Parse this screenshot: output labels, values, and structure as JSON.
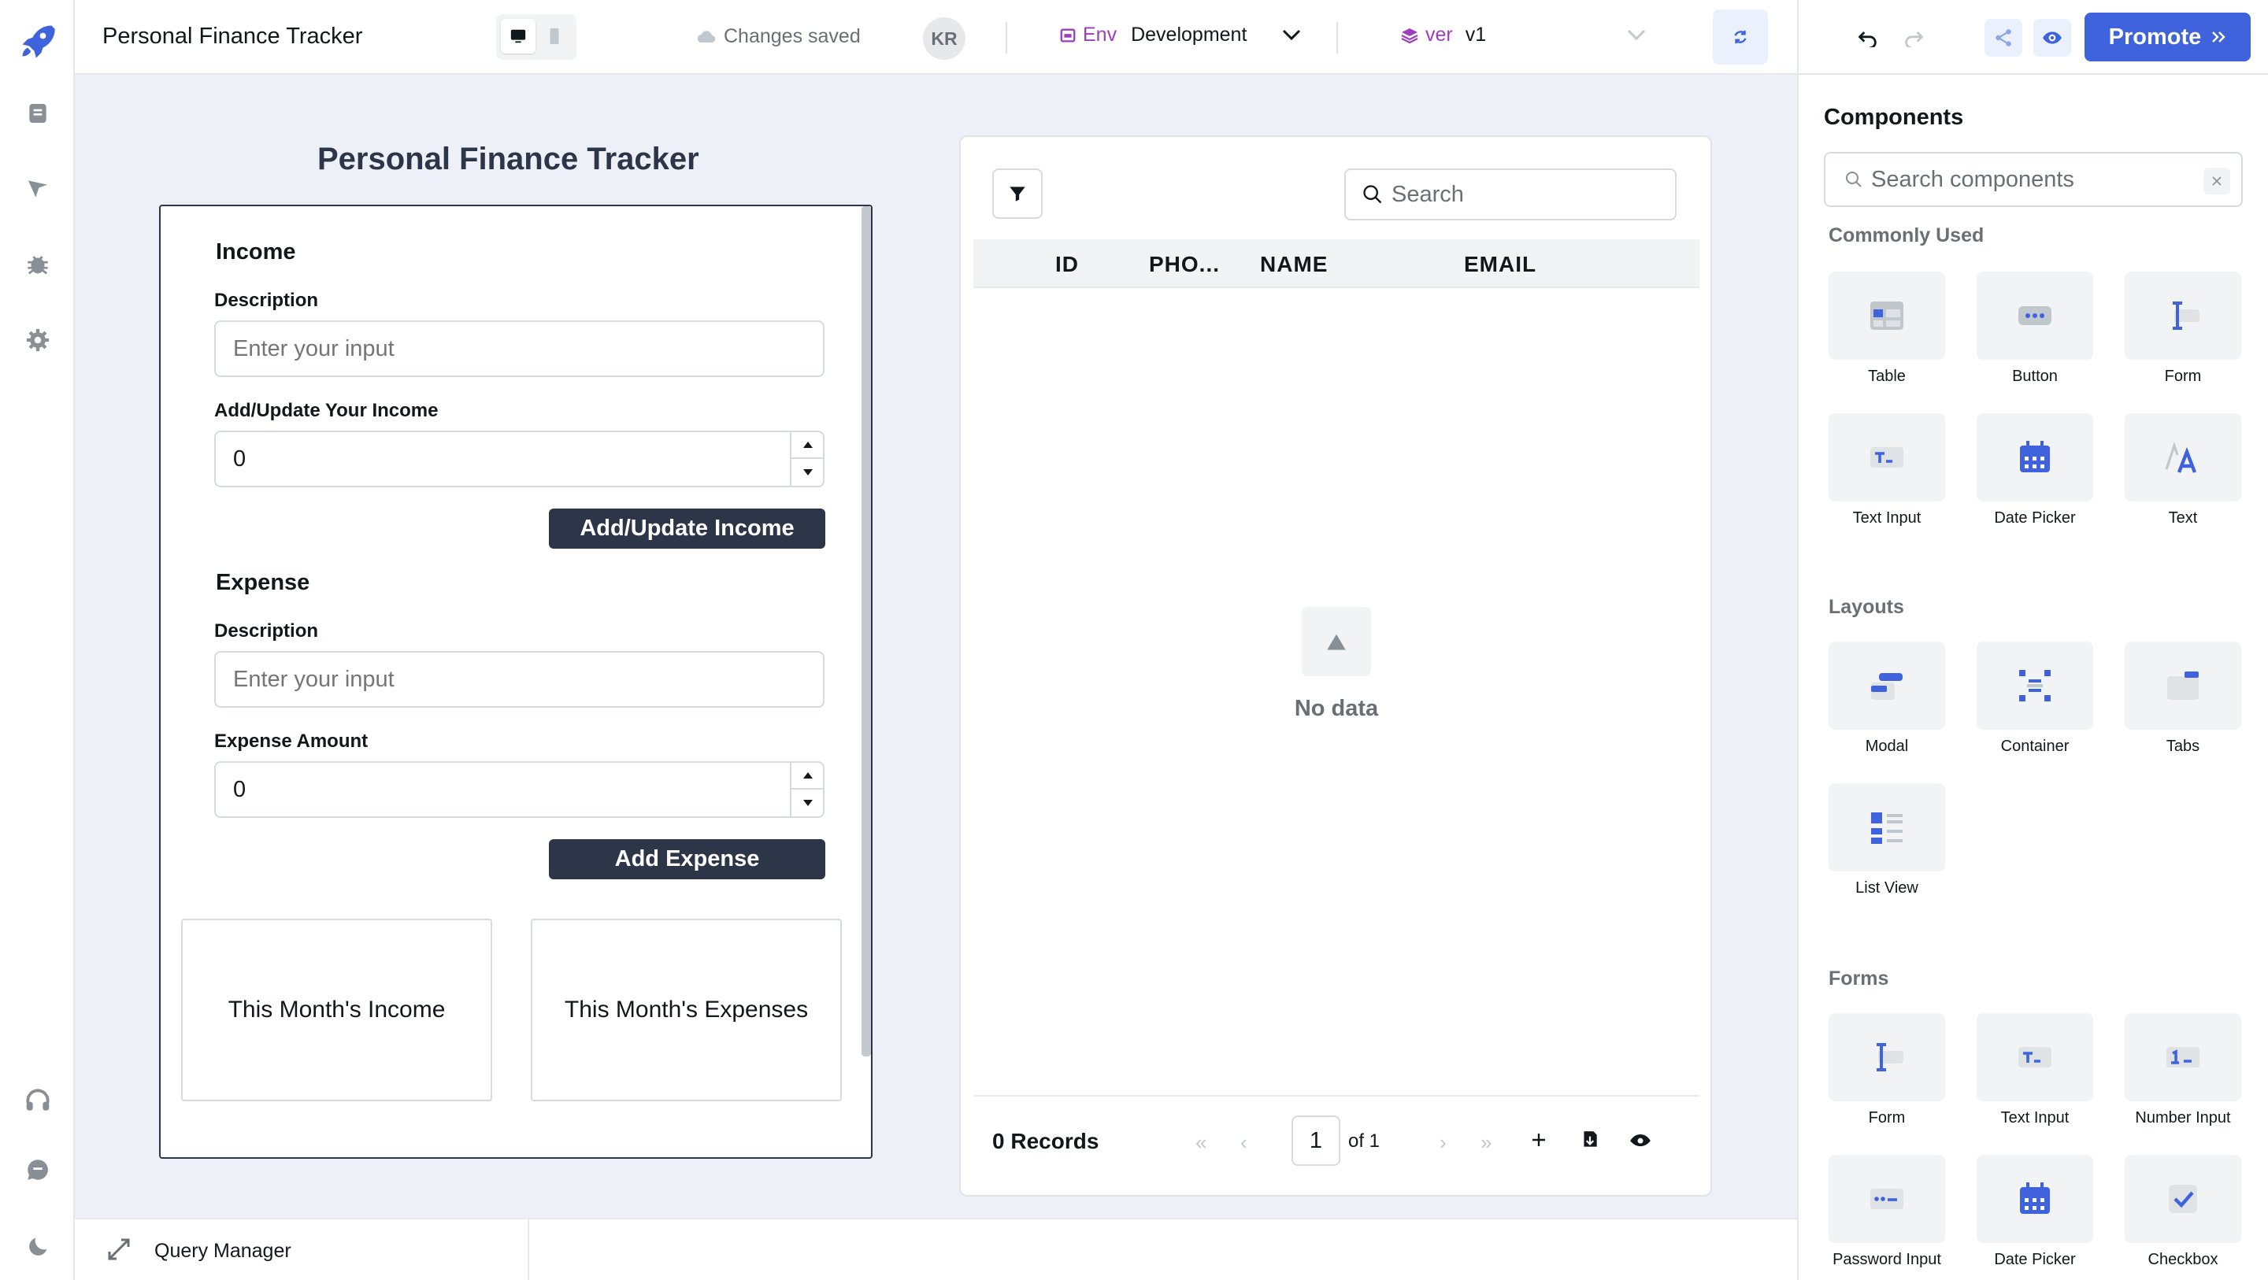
{
  "header": {
    "app_name": "Personal Finance Tracker",
    "save_status": "Changes saved",
    "avatar_initials": "KR",
    "env_label": "Env",
    "env_value": "Development",
    "version_label": "ver",
    "version_value": "v1",
    "promote_label": "Promote"
  },
  "canvas": {
    "title": "Personal Finance Tracker",
    "form": {
      "income": {
        "title": "Income",
        "description_label": "Description",
        "description_placeholder": "Enter your input",
        "amount_label": "Add/Update Your Income",
        "amount_value": "0",
        "button_label": "Add/Update Income"
      },
      "expense": {
        "title": "Expense",
        "description_label": "Description",
        "description_placeholder": "Enter your input",
        "amount_label": "Expense Amount",
        "amount_value": "0",
        "button_label": "Add Expense"
      },
      "cards": {
        "income": "This Month's Income",
        "expenses": "This Month's Expenses"
      }
    },
    "table": {
      "search_placeholder": "Search",
      "columns": [
        "ID",
        "PHO...",
        "NAME",
        "EMAIL"
      ],
      "empty_text": "No data",
      "records": "0 Records",
      "page": "1",
      "page_of": "of 1"
    }
  },
  "query_manager": {
    "label": "Query Manager"
  },
  "panel": {
    "title": "Components",
    "search_placeholder": "Search components",
    "groups": {
      "common": {
        "title": "Commonly Used",
        "items": [
          "Table",
          "Button",
          "Form",
          "Text Input",
          "Date Picker",
          "Text"
        ]
      },
      "layouts": {
        "title": "Layouts",
        "items": [
          "Modal",
          "Container",
          "Tabs",
          "List View"
        ]
      },
      "forms": {
        "title": "Forms",
        "items": [
          "Form",
          "Text Input",
          "Number Input",
          "Password Input",
          "Date Picker",
          "Checkbox"
        ]
      }
    }
  },
  "icons": {
    "rail": [
      "rocket-icon",
      "pages-icon",
      "inspector-icon",
      "debugger-icon",
      "settings-icon",
      "support-icon",
      "chat-icon",
      "theme-moon-icon"
    ]
  },
  "colors": {
    "accent": "#3e63dd",
    "dark_button": "#2d3648",
    "canvas_bg": "#edf1f7",
    "env_purple": "#9e3dbe"
  }
}
